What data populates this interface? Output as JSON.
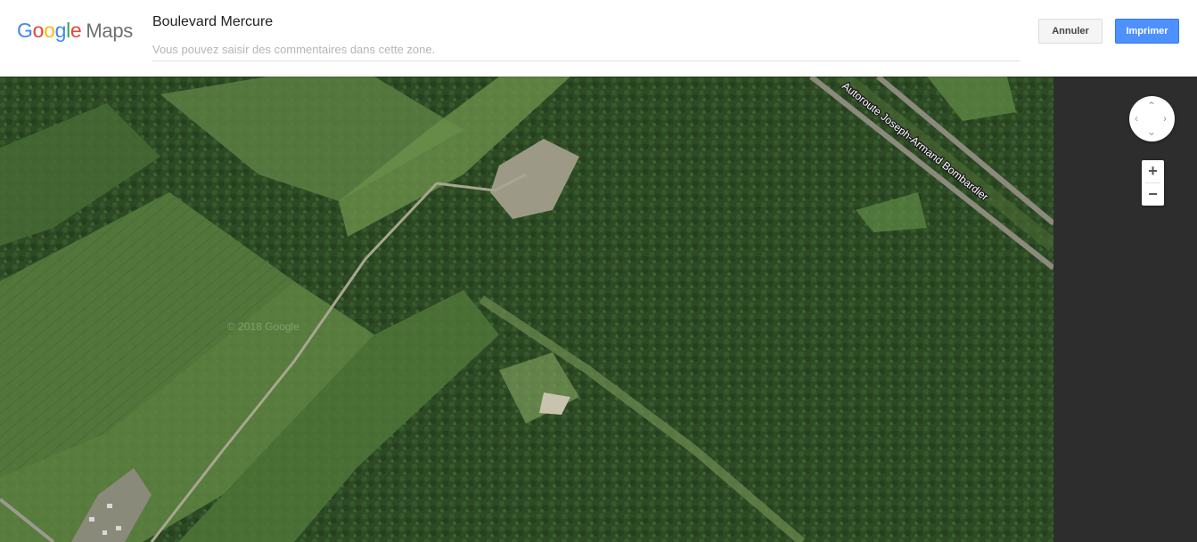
{
  "header": {
    "logo": {
      "letters": [
        {
          "char": "G",
          "color": "#4285F4"
        },
        {
          "char": "o",
          "color": "#EA4335"
        },
        {
          "char": "o",
          "color": "#FBBC05"
        },
        {
          "char": "g",
          "color": "#4285F4"
        },
        {
          "char": "l",
          "color": "#34A853"
        },
        {
          "char": "e",
          "color": "#EA4335"
        }
      ],
      "suffix": "Maps"
    },
    "title": "Boulevard Mercure",
    "comment_placeholder": "Vous pouvez saisir des commentaires dans cette zone.",
    "comment_value": "",
    "cancel_label": "Annuler",
    "print_label": "Imprimer"
  },
  "map": {
    "view": "satellite",
    "road_label": "Autoroute Joseph-Armand Bombardier",
    "watermark": "© 2018 Google"
  },
  "controls": {
    "pan_icons": [
      "chevron-up-icon",
      "chevron-left-icon",
      "chevron-right-icon",
      "chevron-down-icon"
    ],
    "zoom_in_label": "+",
    "zoom_out_label": "−"
  },
  "colors": {
    "print_button": "#4d90fe",
    "cancel_button": "#f5f5f5",
    "gutter": "#2d2d2d"
  }
}
